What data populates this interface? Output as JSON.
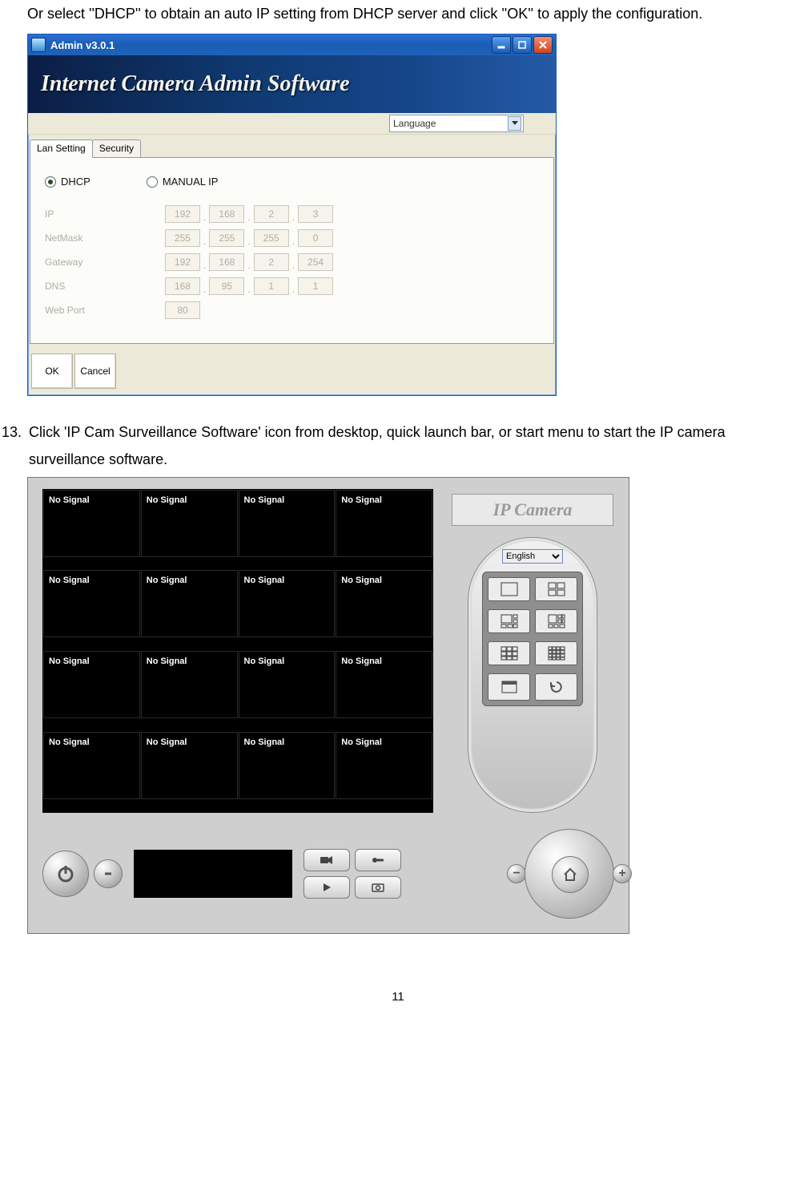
{
  "intro_text": "Or select ''DHCP'' to obtain an auto IP setting from DHCP server and click ''OK'' to apply the configuration.",
  "step13_num": "13.",
  "step13_text": "Click 'IP Cam Surveillance Software' icon from desktop, quick launch bar, or start menu to start the IP camera surveillance software.",
  "page_number": "11",
  "admin": {
    "title": "Admin v3.0.1",
    "banner": "Internet Camera Admin Software",
    "language_label": "Language",
    "tabs": {
      "lan": "Lan Setting",
      "security": "Security"
    },
    "radios": {
      "dhcp": "DHCP",
      "manual": "MANUAL IP"
    },
    "labels": {
      "ip": "IP",
      "netmask": "NetMask",
      "gateway": "Gateway",
      "dns": "DNS",
      "webport": "Web Port"
    },
    "ip": [
      "192",
      "168",
      "2",
      "3"
    ],
    "netmask": [
      "255",
      "255",
      "255",
      "0"
    ],
    "gateway": [
      "192",
      "168",
      "2",
      "254"
    ],
    "dns": [
      "168",
      "95",
      "1",
      "1"
    ],
    "webport": "80",
    "buttons": {
      "ok": "OK",
      "cancel": "Cancel"
    }
  },
  "surv": {
    "logo": "IP Camera",
    "no_signal": "No Signal",
    "lang_selected": "English"
  }
}
